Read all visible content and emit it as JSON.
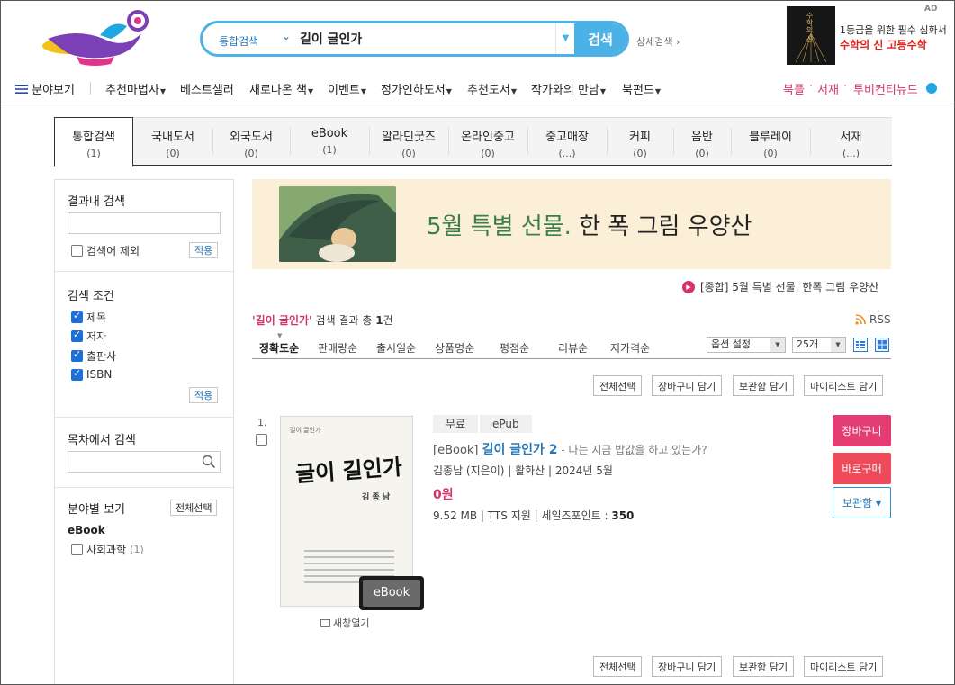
{
  "header": {
    "search": {
      "category": "통합검색",
      "query": "길이 글인가",
      "button": "검색"
    },
    "detail_search": "상세검색 ›",
    "ad": {
      "label": "AD",
      "book_title": "수학의 신",
      "line1": "1등급을 위한 필수 심화서",
      "line2": "수학의 신 고등수학"
    },
    "nav": {
      "menu": "분야보기",
      "items": [
        {
          "label": "추천마법사",
          "caret": true
        },
        {
          "label": "베스트셀러",
          "caret": false
        },
        {
          "label": "새로나온 책",
          "caret": true
        },
        {
          "label": "이벤트",
          "caret": true
        },
        {
          "label": "정가인하도서",
          "caret": true
        },
        {
          "label": "추천도서",
          "caret": true
        },
        {
          "label": "작가와의 만남",
          "caret": true
        },
        {
          "label": "북펀드",
          "caret": true
        }
      ],
      "right": [
        "북플",
        "서재",
        "투비컨티뉴드"
      ]
    }
  },
  "tabs": [
    {
      "label": "통합검색",
      "count": "(1)",
      "active": true
    },
    {
      "label": "국내도서",
      "count": "(0)"
    },
    {
      "label": "외국도서",
      "count": "(0)"
    },
    {
      "label": "eBook",
      "count": "(1)"
    },
    {
      "label": "알라딘굿즈",
      "count": "(0)"
    },
    {
      "label": "온라인중고",
      "count": "(0)"
    },
    {
      "label": "중고매장",
      "count": "(...)"
    },
    {
      "label": "커피",
      "count": "(0)"
    },
    {
      "label": "음반",
      "count": "(0)"
    },
    {
      "label": "블루레이",
      "count": "(0)"
    },
    {
      "label": "서재",
      "count": "(...)"
    }
  ],
  "left_panel": {
    "in_result_title": "결과내 검색",
    "exclude_label": "검색어 제외",
    "apply": "적용",
    "conditions_title": "검색 조건",
    "conditions": [
      "제목",
      "저자",
      "출판사",
      "ISBN"
    ],
    "toc_title": "목차에서 검색",
    "category_title": "분야별 보기",
    "select_all": "전체선택",
    "category_group": "eBook",
    "category_item": "사회과학",
    "category_count": "(1)"
  },
  "banner": {
    "highlight": "5월 특별 선물.",
    "rest": " 한 폭 그림 우양산"
  },
  "promo": "[종합] 5월 특별 선물. 한폭 그림 우양산",
  "result": {
    "query": "'길이 글인가'",
    "text": " 검색 결과 총 ",
    "count": "1",
    "suffix": "건",
    "rss": "RSS"
  },
  "sort": {
    "items": [
      "정확도순",
      "판매량순",
      "출시일순",
      "상품명순",
      "평점순",
      "리뷰순",
      "저가격순"
    ],
    "option": "옵션 설정",
    "per_page": "25개"
  },
  "actions": [
    "전체선택",
    "장바구니 담기",
    "보관함 담기",
    "마이리스트 담기"
  ],
  "item": {
    "number": "1.",
    "tags": [
      "무료",
      "ePub"
    ],
    "prefix": "[eBook] ",
    "title": "길이 글인가 2",
    "subtitle": " - 나는 지금 밥값을 하고 있는가?",
    "meta": "김종남 (지은이) | 활화산 | 2024년 5월",
    "price": "0원",
    "extra": "9.52 MB | TTS 지원 | 세일즈포인트 : ",
    "sales_point": "350",
    "cover_title": "글이 길인가",
    "cover_author": "김 종 남",
    "badge": "eBook",
    "new_window": "새창열기",
    "btn_cart": "장바구니",
    "btn_buy": "바로구매",
    "btn_keep": "보관함 ▾"
  },
  "colors": {
    "accent_blue": "#4cb1e6",
    "pink": "#d5346b",
    "banner_bg": "#fcefd8"
  }
}
